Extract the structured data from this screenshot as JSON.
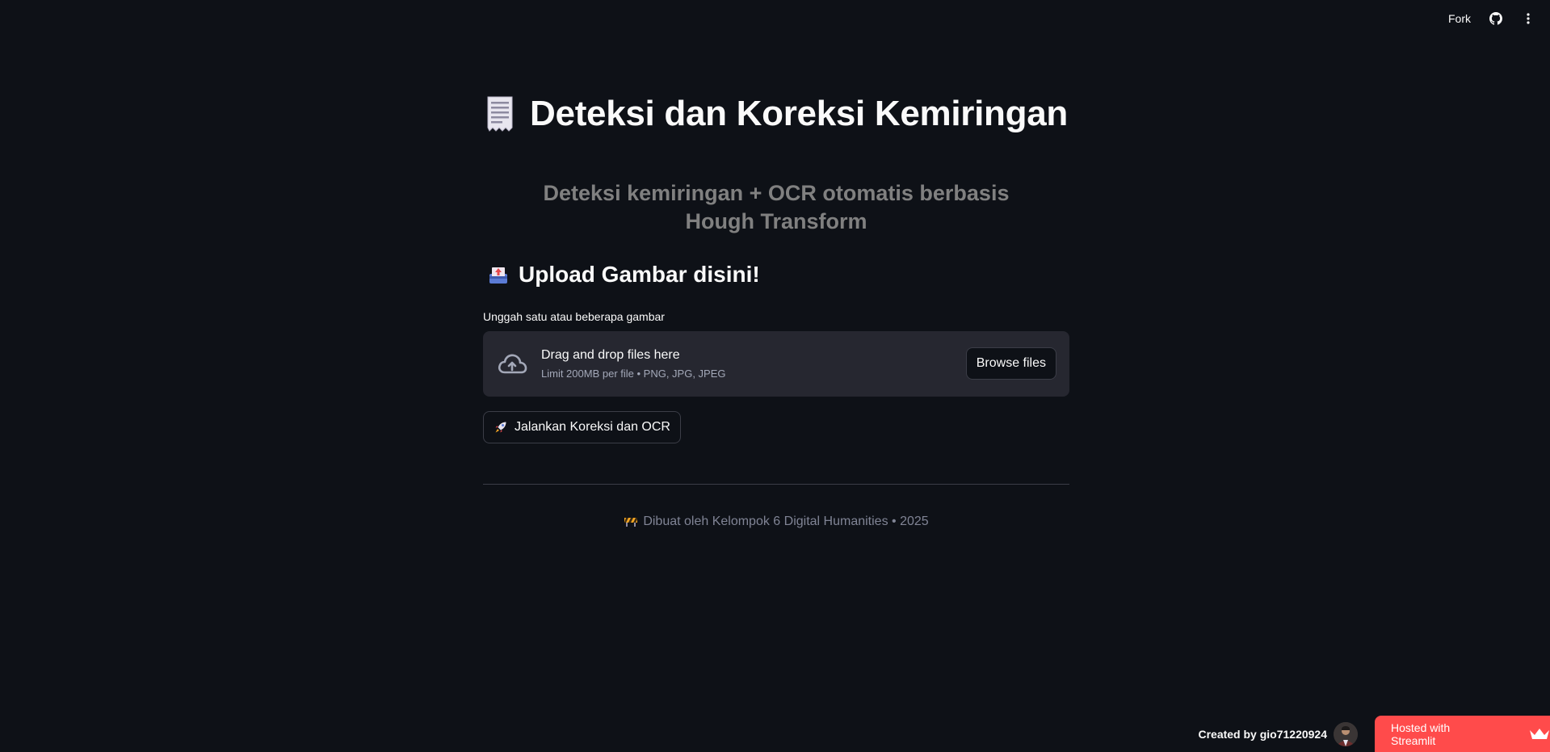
{
  "toolbar": {
    "fork_label": "Fork",
    "github_icon": "github-icon",
    "menu_icon": "kebab-menu-icon"
  },
  "header": {
    "title_emoji": "receipt-icon",
    "title": "Deteksi dan Koreksi Kemiringan",
    "subtitle": "Deteksi kemiringan + OCR otomatis berbasis Hough Transform"
  },
  "upload": {
    "heading_emoji": "inbox-tray-icon",
    "heading": "Upload Gambar disini!",
    "label": "Unggah satu atau beberapa gambar",
    "dropzone_text": "Drag and drop files here",
    "limit_text": "Limit 200MB per file • PNG, JPG, JPEG",
    "browse_label": "Browse files"
  },
  "actions": {
    "run_label": "Jalankan Koreksi dan OCR"
  },
  "footer": {
    "note": "Dibuat oleh Kelompok 6 Digital Humanities • 2025"
  },
  "badges": {
    "created_by": "Created by gio71220924",
    "hosted": "Hosted with Streamlit"
  },
  "colors": {
    "background": "#0e1117",
    "surface": "#262730",
    "streamlit_red": "#ff4b4b",
    "muted_text": "#808080"
  }
}
